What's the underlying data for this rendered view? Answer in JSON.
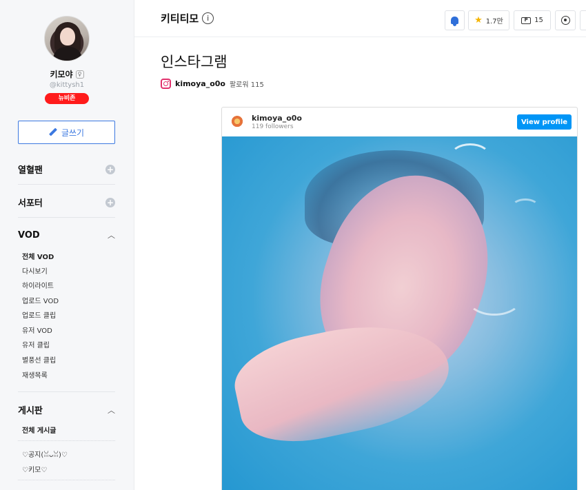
{
  "sidebar": {
    "nickname": "키모야",
    "user_id": "@kittysh1",
    "badge": "뉴비존",
    "write_button": "글쓰기",
    "sections": [
      {
        "label": "열혈팬"
      },
      {
        "label": "서포터"
      },
      {
        "label": "VOD"
      },
      {
        "label": "게시판"
      }
    ],
    "vod_items": [
      "전체 VOD",
      "다시보기",
      "하이라이트",
      "업로드 VOD",
      "업로드 클립",
      "유저 VOD",
      "유저 클립",
      "별풍선 클립",
      "재생목록"
    ],
    "board_items": [
      "전체 게시글",
      "♡공지(ꈍᴗꈍ)♡",
      "♡키모♡"
    ]
  },
  "header": {
    "channel_title": "키티티모",
    "info_icon": "i",
    "stars": "1.7만",
    "tickets": "15",
    "ticket_glyph": "P"
  },
  "main": {
    "page_title": "인스타그램",
    "ig_handle": "kimoya_o0o",
    "ig_followers": "팔로워 115"
  },
  "embed": {
    "username": "kimoya_o0o",
    "followers": "119 followers",
    "view_profile": "View profile"
  },
  "icons": [
    "bell-icon",
    "star-icon",
    "ticket-icon",
    "medal-icon",
    "instagram-icon",
    "pen-icon",
    "plus-icon",
    "chevron-up-icon",
    "info-icon"
  ],
  "colors": {
    "accent_blue": "#3b78e0",
    "instagram_blue": "#0095f6",
    "newbie_red": "#ff1b1b",
    "instagram_pink": "#e1306c"
  }
}
